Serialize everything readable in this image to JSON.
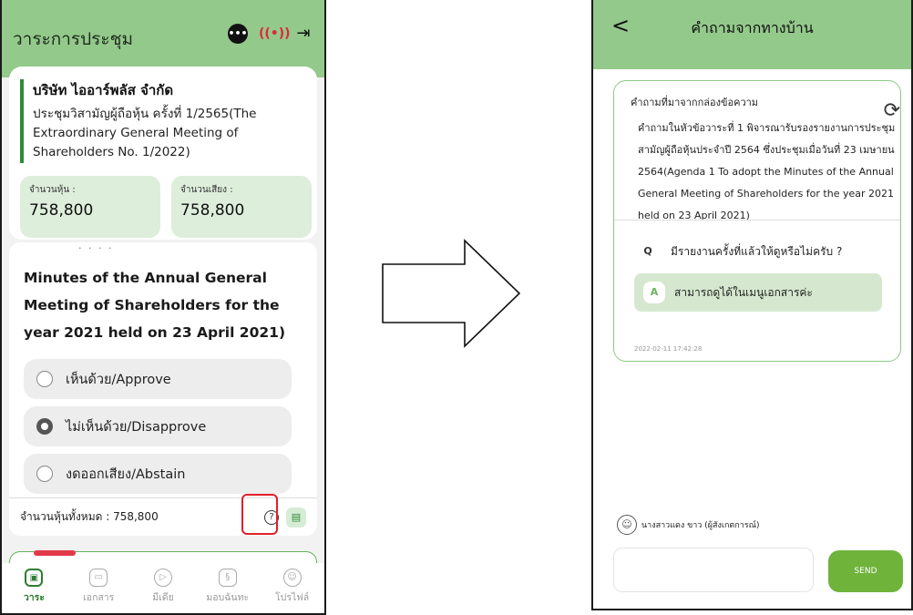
{
  "left": {
    "header": {
      "title": "วาระการประชุม",
      "chat_icon": "chat-bubble-icon",
      "live_icon": "live-broadcast-icon",
      "live_text": "LIVE",
      "logout_icon": "logout-icon"
    },
    "company": {
      "name": "บริษัท ไออาร์พลัส จำกัด",
      "meeting": "ประชุมวิสามัญผู้ถือหุ้น ครั้งที่ 1/2565(The Extraordinary General Meeting of Shareholders No. 1/2022)",
      "shares_label": "จำนวนหุ้น :",
      "shares_value": "758,800",
      "votes_label": "จำนวนเสียง :",
      "votes_value": "758,800"
    },
    "agenda": {
      "text": "Minutes of the Annual General Meeting of Shareholders for the year 2021 held on 23 April 2021)",
      "options": [
        {
          "label": "เห็นด้วย/Approve",
          "selected": false
        },
        {
          "label": "ไม่เห็นด้วย/Disapprove",
          "selected": true
        },
        {
          "label": "งดออกเสียง/Abstain",
          "selected": false
        }
      ],
      "total": "จำนวนหุ้นทั้งหมด : 758,800"
    },
    "nav": [
      {
        "label": "วาระ",
        "icon": "agenda-icon",
        "active": true
      },
      {
        "label": "เอกสาร",
        "icon": "folder-icon",
        "active": false
      },
      {
        "label": "มีเดีย",
        "icon": "play-icon",
        "active": false
      },
      {
        "label": "มอบฉันทะ",
        "icon": "proxy-icon",
        "active": false
      },
      {
        "label": "โปรไฟล์",
        "icon": "profile-icon",
        "active": false
      }
    ]
  },
  "right": {
    "header": {
      "title": "คำถามจากทางบ้าน",
      "back": "<"
    },
    "question_card": {
      "source": "คำถามที่มาจากกล่องข้อความ",
      "agenda": "คำถามในหัวข้อวาระที่ 1 พิจารณารับรองรายงานการประชุมสามัญผู้ถือหุ้นประจำปี 2564 ซึ่งประชุมเมื่อวันที่ 23 เมษายน 2564(Agenda 1 To adopt the Minutes of the Annual General Meeting of Shareholders for the year 2021 held on 23 April 2021)",
      "q_letter": "Q",
      "question": "มีรายงานครั้งที่แล้วให้ดูหรือไม่ครับ ?",
      "a_letter": "A",
      "answer": "สามารถดูได้ในเมนูเอกสารค่ะ",
      "timestamp": "2022-02-11 17:42:28"
    },
    "user": "นางสาวแดง ขาว (ผู้สังเกตการณ์)",
    "message_value": "",
    "send_label": "SEND"
  },
  "colors": {
    "header_green": "#93c98a",
    "accent_green": "#2e8a3a",
    "send_green": "#6fb33b",
    "highlight_red": "#e0202a"
  }
}
